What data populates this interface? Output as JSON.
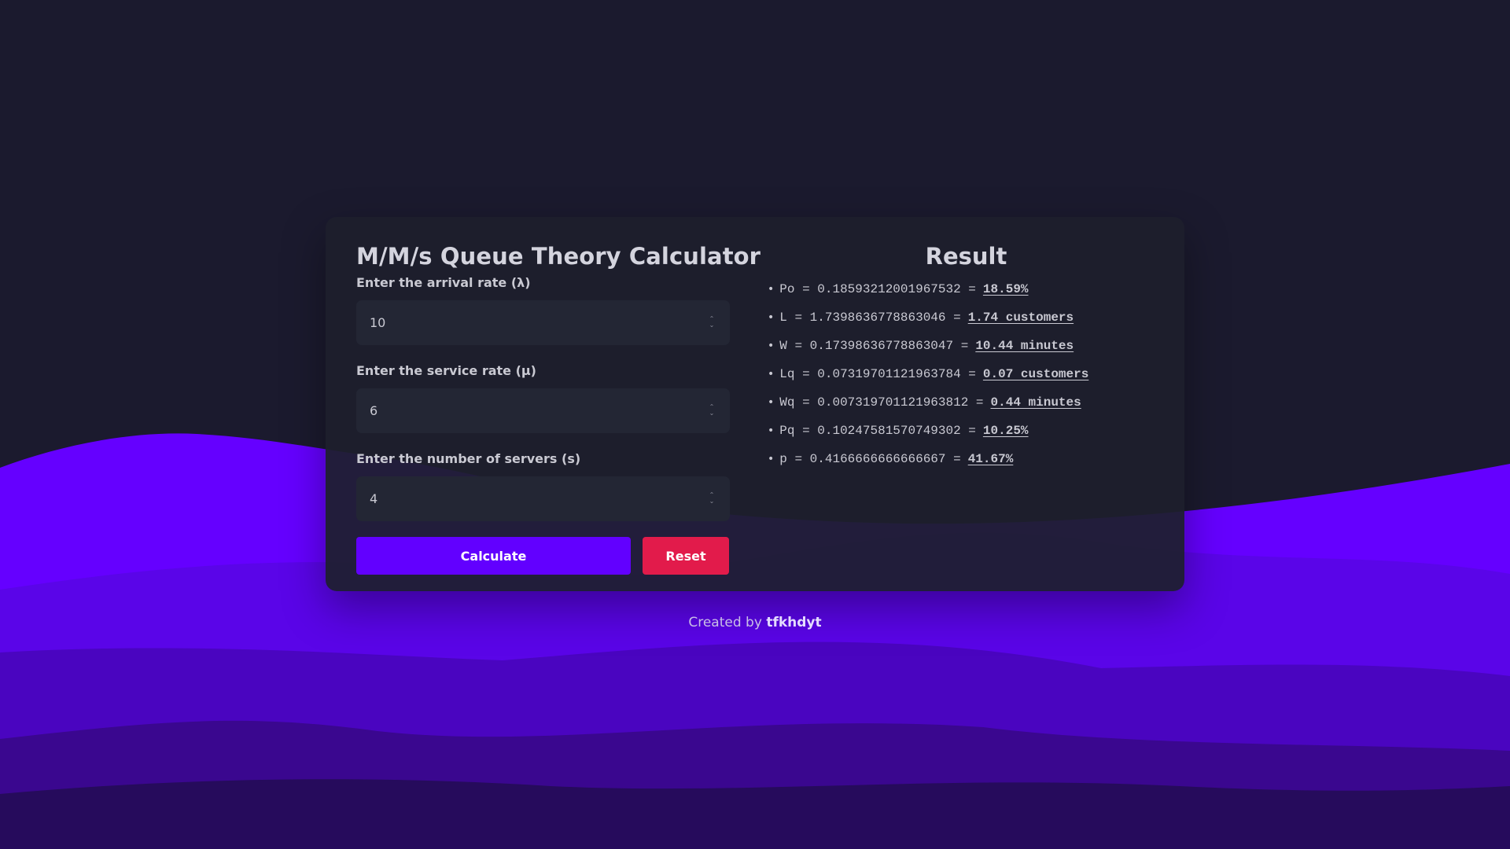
{
  "app": {
    "title": "M/M/s Queue Theory Calculator"
  },
  "form": {
    "arrival_label": "Enter the arrival rate (λ)",
    "arrival_value": "10",
    "service_label": "Enter the service rate (μ)",
    "service_value": "6",
    "servers_label": "Enter the number of servers (s)",
    "servers_value": "4",
    "calculate_label": "Calculate",
    "reset_label": "Reset"
  },
  "result": {
    "title": "Result",
    "items": [
      {
        "expr": "Po = 0.18593212001967532 =",
        "value": "18.59%"
      },
      {
        "expr": "L = 1.7398636778863046 =",
        "value": "1.74 customers"
      },
      {
        "expr": "W = 0.17398636778863047 =",
        "value": "10.44 minutes"
      },
      {
        "expr": "Lq = 0.07319701121963784 =",
        "value": "0.07 customers"
      },
      {
        "expr": "Wq = 0.007319701121963812 =",
        "value": "0.44 minutes"
      },
      {
        "expr": "Pq = 0.10247581570749302 =",
        "value": "10.25%"
      },
      {
        "expr": "p = 0.4166666666666667 =",
        "value": "41.67%"
      }
    ]
  },
  "footer": {
    "prefix": "Created by",
    "author": "tfkhdyt"
  },
  "colors": {
    "background": "#1b1a2e",
    "card": "#1d1f2c",
    "primary": "#6200ff",
    "danger": "#e21b4b",
    "wave_light": "#6500ff",
    "wave_dark": "#260b5c"
  },
  "icons": {
    "input_spinner": "up-down-chevrons"
  }
}
